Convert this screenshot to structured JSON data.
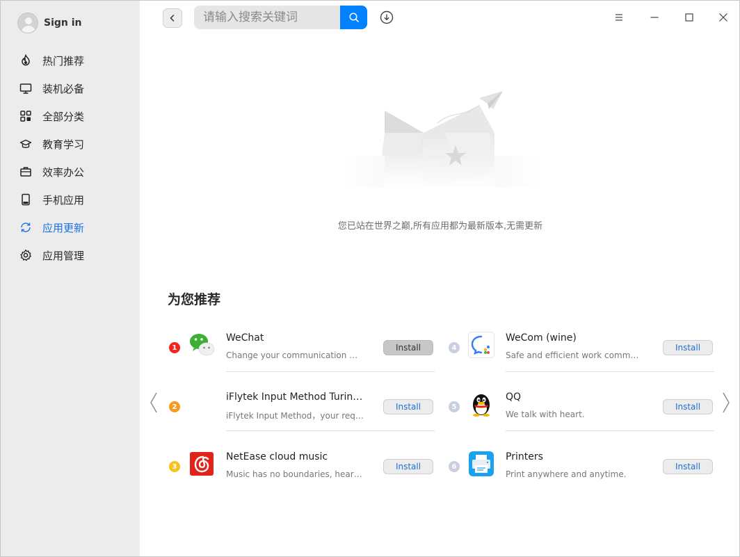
{
  "sidebar": {
    "signin_label": "Sign in",
    "items": [
      {
        "label": "热门推荐",
        "icon": "flame-icon"
      },
      {
        "label": "装机必备",
        "icon": "monitor-icon"
      },
      {
        "label": "全部分类",
        "icon": "grid-icon"
      },
      {
        "label": "教育学习",
        "icon": "graduation-cap-icon"
      },
      {
        "label": "效率办公",
        "icon": "briefcase-icon"
      },
      {
        "label": "手机应用",
        "icon": "phone-icon"
      },
      {
        "label": "应用更新",
        "icon": "refresh-icon",
        "active": true
      },
      {
        "label": "应用管理",
        "icon": "gear-icon"
      }
    ]
  },
  "search": {
    "placeholder": "请输入搜索关键词"
  },
  "empty_state": {
    "message": "您已站在世界之巅,所有应用都为最新版本,无需更新"
  },
  "recommend": {
    "title": "为您推荐",
    "install_label": "Install",
    "apps": [
      {
        "rank": "1",
        "name": "WeChat",
        "desc": "Change your communication way.",
        "rank_color": "#f2261c"
      },
      {
        "rank": "2",
        "name": "iFlytek Input Method Turing …",
        "desc": "iFlytek Input Method，your requi…",
        "rank_color": "#f59a23"
      },
      {
        "rank": "3",
        "name": "NetEase cloud music",
        "desc": "Music has no boundaries, hear g…",
        "rank_color": "#f7c21f"
      },
      {
        "rank": "4",
        "name": "WeCom (wine)",
        "desc": "Safe and efficient work communi…",
        "rank_color": "#c9cfe0"
      },
      {
        "rank": "5",
        "name": "QQ",
        "desc": "We talk with heart.",
        "rank_color": "#c9cfe0"
      },
      {
        "rank": "6",
        "name": "Printers",
        "desc": "Print anywhere and anytime.",
        "rank_color": "#c9cfe0"
      }
    ]
  },
  "colors": {
    "accent": "#0081ff",
    "active_nav": "#1a73e8",
    "sidebar_bg": "#ececec"
  }
}
